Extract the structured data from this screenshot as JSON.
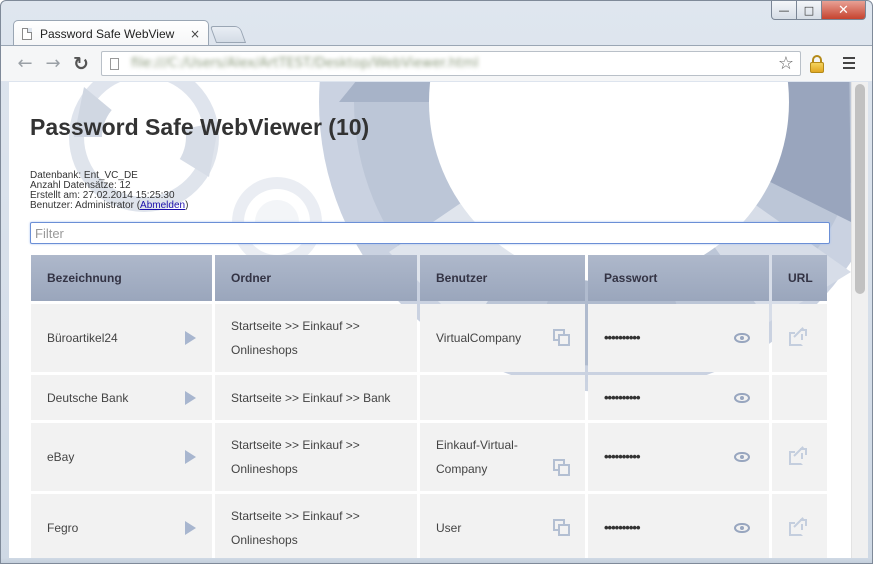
{
  "browser": {
    "tab_title": "Password Safe WebView",
    "tab_close": "×",
    "address_url": "file:///C:/Users/Alex/ArtTEST/Desktop/WebViewer.html",
    "win_min": "—",
    "win_max": "□",
    "win_close": "✕",
    "nav_back": "←",
    "nav_forward": "→",
    "nav_reload": "↻",
    "star": "☆"
  },
  "page": {
    "title": "Password Safe WebViewer (10)",
    "meta": {
      "database": "Datenbank: Ent_VC_DE",
      "record_count": "Anzahl Datensätze: 12",
      "created": "Erstellt am: 27.02.2014 15:25:30",
      "user_prefix": "Benutzer: Administrator (",
      "logout_link": "Abmelden",
      "user_suffix": ")"
    },
    "filter_placeholder": "Filter"
  },
  "table": {
    "headers": [
      "Bezeichnung",
      "Ordner",
      "Benutzer",
      "Passwort",
      "URL"
    ],
    "rows": [
      {
        "name": "Büroartikel24",
        "folder": "Startseite >> Einkauf >> Onlineshops",
        "user": "VirtualCompany",
        "password": "••••••••••",
        "has_url": true
      },
      {
        "name": "Deutsche Bank",
        "folder": "Startseite >> Einkauf >> Bank",
        "user": "",
        "password": "••••••••••",
        "has_url": false
      },
      {
        "name": "eBay",
        "folder": "Startseite >> Einkauf >> Onlineshops",
        "user": "Einkauf-Virtual-Company",
        "password": "••••••••••",
        "has_url": true
      },
      {
        "name": "Fegro",
        "folder": "Startseite >> Einkauf >> Onlineshops",
        "user": "User",
        "password": "••••••••••",
        "has_url": true
      }
    ]
  },
  "colors": {
    "header_bg": "#9aa6bc",
    "cell_bg": "#f2f2f2",
    "icon_blue": "#a8b6cf",
    "link": "#1a0dab",
    "filter_border": "#6b8fd6"
  }
}
